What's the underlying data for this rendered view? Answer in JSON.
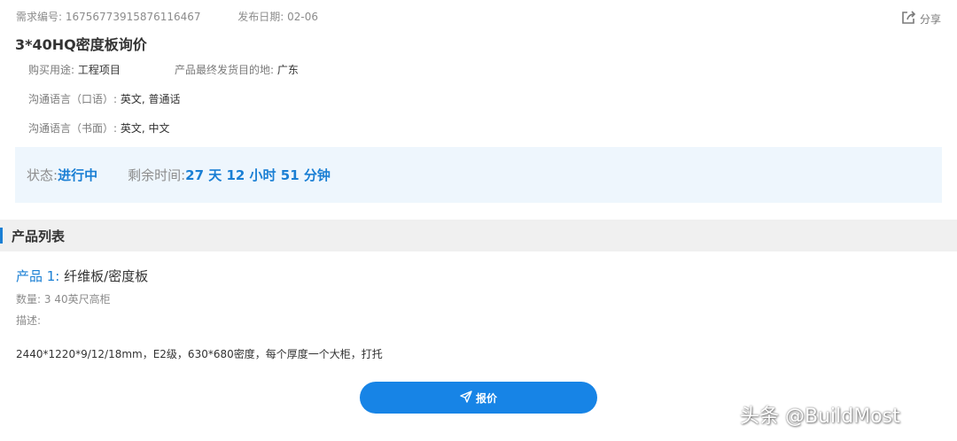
{
  "meta": {
    "req_no_label": "需求编号:",
    "req_no": "16756773915876116467",
    "date_label": "发布日期:",
    "date": "02-06"
  },
  "share": {
    "label": "分享",
    "icon": "share-icon"
  },
  "title": "3*40HQ密度板询价",
  "info": {
    "purpose_label": "购买用途:",
    "purpose": "工程项目",
    "dest_label": "产品最终发货目的地:",
    "dest": "广东",
    "spoken_label": "沟通语言（口语）:",
    "spoken": "英文, 普通话",
    "written_label": "沟通语言（书面）:",
    "written": "英文, 中文"
  },
  "status": {
    "state_label": "状态:",
    "state": "进行中",
    "remain_label": "剩余时间:",
    "remain": "27 天 12 小时 51 分钟"
  },
  "section": {
    "title": "产品列表"
  },
  "product": {
    "index_label": "产品 1:",
    "name": "纤维板/密度板",
    "qty_label": "数量:",
    "qty": "3 40英尺高柜",
    "desc_label": "描述:",
    "desc": "2440*1220*9/12/18mm，E2级，630*680密度，每个厚度一个大柜，打托"
  },
  "quote_button": {
    "label": "报价",
    "icon": "paper-plane-icon"
  },
  "watermark": "头条 @BuildMost",
  "colors": {
    "accent": "#1a7fd4",
    "button": "#1784e6",
    "status_bg": "#eef6fd",
    "section_bg": "#f0f0f0"
  }
}
